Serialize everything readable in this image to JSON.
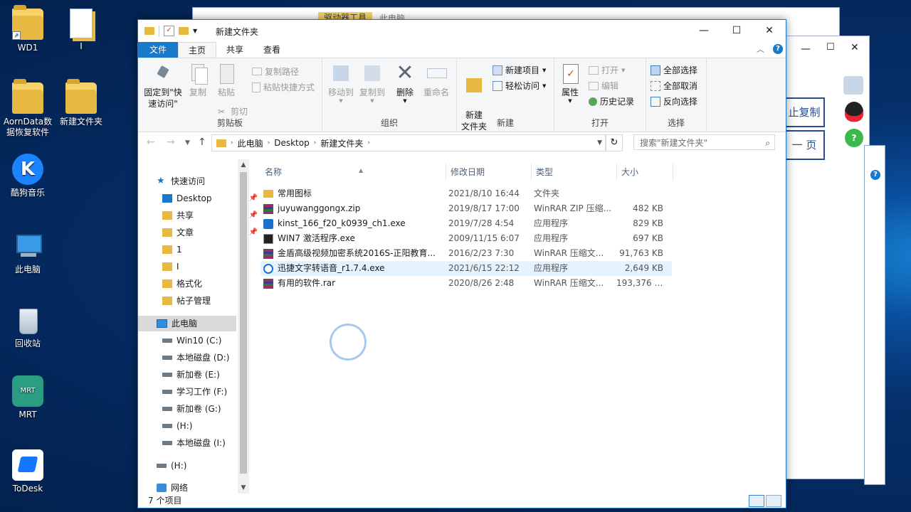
{
  "desktop_icons": [
    {
      "label": "WD1"
    },
    {
      "label": "I"
    },
    {
      "label": "AornData数据恢复软件"
    },
    {
      "label": "新建文件夹"
    },
    {
      "label": "酷狗音乐"
    },
    {
      "label": "此电脑"
    },
    {
      "label": "回收站"
    },
    {
      "label": "MRT"
    },
    {
      "label": "ToDesk"
    }
  ],
  "bg_windows": {
    "tab_label": "驱动器工具",
    "title": "此电脑",
    "button_stop_copy": "止复制",
    "button_page": "一 页"
  },
  "window": {
    "title": "新建文件夹",
    "minimize": "—",
    "maximize": "☐",
    "close": "✕"
  },
  "tabs": [
    "文件",
    "主页",
    "共享",
    "查看"
  ],
  "ribbon": {
    "clipboard": {
      "name": "剪贴板",
      "pin": "固定到\"快速访问\"",
      "copy": "复制",
      "paste": "粘贴",
      "copy_path": "复制路径",
      "paste_shortcut": "粘贴快捷方式",
      "cut": "剪切"
    },
    "organize": {
      "name": "组织",
      "move_to": "移动到",
      "copy_to": "复制到",
      "delete": "删除",
      "rename": "重命名"
    },
    "new": {
      "name": "新建",
      "new_folder": "新建\n文件夹",
      "new_item": "新建项目",
      "easy_access": "轻松访问"
    },
    "open": {
      "name": "打开",
      "properties": "属性",
      "open": "打开",
      "edit": "编辑",
      "history": "历史记录"
    },
    "select": {
      "name": "选择",
      "select_all": "全部选择",
      "select_none": "全部取消",
      "invert": "反向选择"
    }
  },
  "address": {
    "crumbs": [
      "此电脑",
      "Desktop",
      "新建文件夹"
    ],
    "search_placeholder": "搜索\"新建文件夹\""
  },
  "nav": {
    "quick_access": "快速访问",
    "items": [
      {
        "label": "Desktop",
        "pinned": true
      },
      {
        "label": "共享",
        "pinned": true
      },
      {
        "label": "文章",
        "pinned": true
      },
      {
        "label": "1"
      },
      {
        "label": "I"
      },
      {
        "label": "格式化"
      },
      {
        "label": "帖子管理"
      }
    ],
    "this_pc": "此电脑",
    "drives": [
      {
        "label": "Win10 (C:)"
      },
      {
        "label": "本地磁盘 (D:)"
      },
      {
        "label": "新加卷 (E:)"
      },
      {
        "label": "学习工作 (F:)"
      },
      {
        "label": "新加卷 (G:)"
      },
      {
        "label": " (H:)"
      },
      {
        "label": "本地磁盘 (I:)"
      }
    ],
    "h_drive": "(H:)",
    "network": "网络"
  },
  "columns": {
    "name": "名称",
    "date": "修改日期",
    "type": "类型",
    "size": "大小"
  },
  "files": [
    {
      "name": "常用图标",
      "date": "2021/8/10 16:44",
      "type": "文件夹",
      "size": "",
      "icon": "folder"
    },
    {
      "name": "juyuwanggongx.zip",
      "date": "2019/8/17 17:00",
      "type": "WinRAR ZIP 压缩...",
      "size": "482 KB",
      "icon": "rar"
    },
    {
      "name": "kinst_166_f20_k0939_ch1.exe",
      "date": "2019/7/28 4:54",
      "type": "应用程序",
      "size": "829 KB",
      "icon": "exe1"
    },
    {
      "name": "WIN7 激活程序.exe",
      "date": "2009/11/15 6:07",
      "type": "应用程序",
      "size": "697 KB",
      "icon": "exe2"
    },
    {
      "name": "金盾高级视频加密系统2016S-正阳教育...",
      "date": "2016/2/23 7:30",
      "type": "WinRAR 压缩文...",
      "size": "91,763 KB",
      "icon": "rar"
    },
    {
      "name": "迅捷文字转语音_r1.7.4.exe",
      "date": "2021/6/15 22:12",
      "type": "应用程序",
      "size": "2,649 KB",
      "icon": "exe3"
    },
    {
      "name": "有用的软件.rar",
      "date": "2020/8/26 2:48",
      "type": "WinRAR 压缩文...",
      "size": "193,376 KB",
      "icon": "rar"
    }
  ],
  "status": {
    "count": "7 个项目"
  }
}
